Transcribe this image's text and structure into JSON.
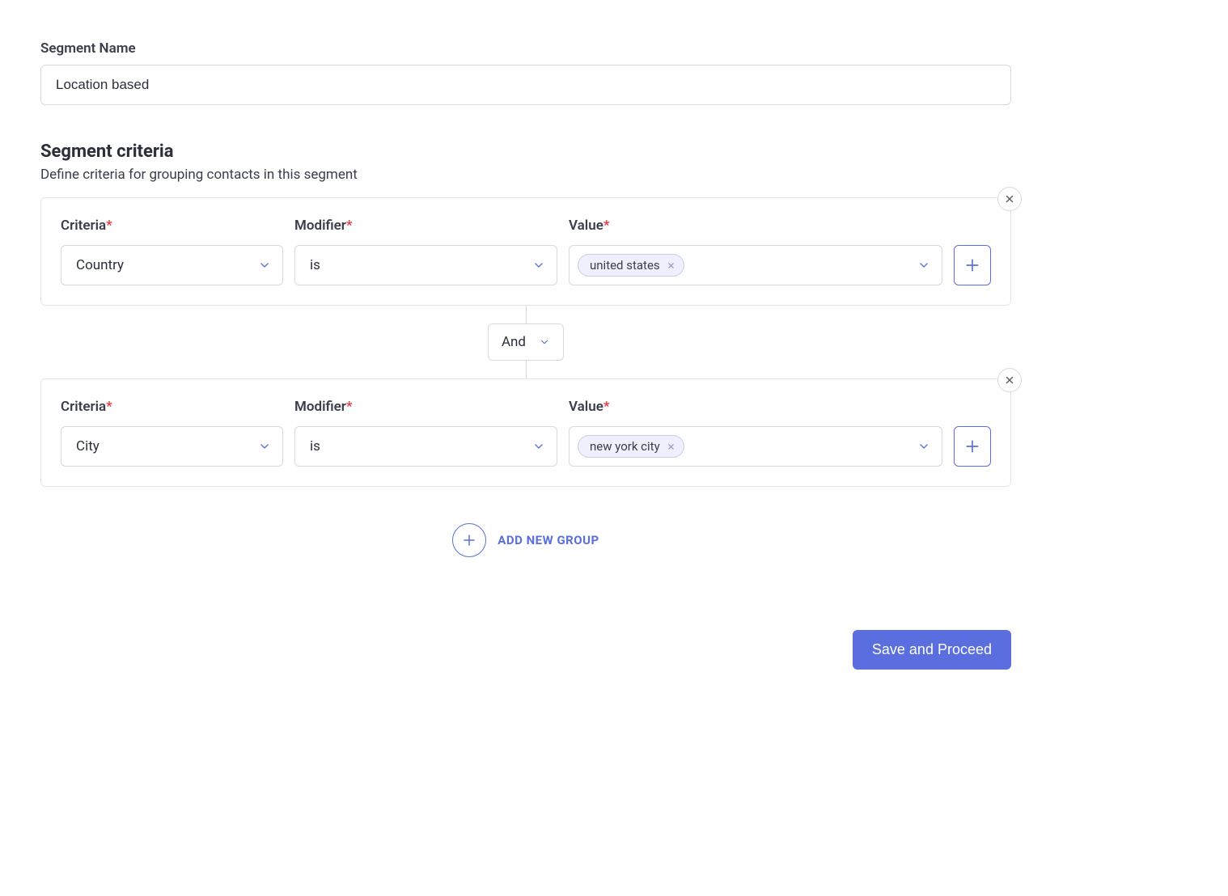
{
  "segmentName": {
    "label": "Segment Name",
    "value": "Location based"
  },
  "criteriaSection": {
    "title": "Segment criteria",
    "description": "Define criteria for grouping contacts in this segment"
  },
  "labels": {
    "criteria": "Criteria",
    "modifier": "Modifier",
    "value": "Value"
  },
  "groups": [
    {
      "criteria": "Country",
      "modifier": "is",
      "values": [
        "united states"
      ]
    },
    {
      "criteria": "City",
      "modifier": "is",
      "values": [
        "new york city"
      ]
    }
  ],
  "operator": "And",
  "addGroup": {
    "label": "ADD NEW GROUP"
  },
  "actions": {
    "saveProceed": "Save and Proceed"
  }
}
